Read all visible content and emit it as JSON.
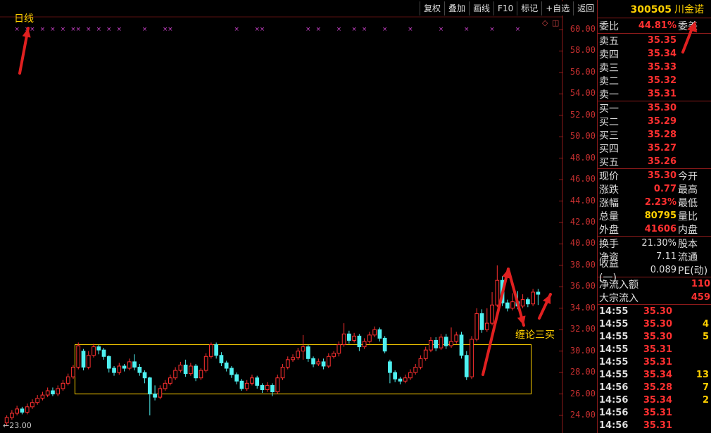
{
  "chart_title": "日线",
  "annotation_chan": "缠论三买",
  "toolbar": [
    "复权",
    "叠加",
    "画线",
    "F10",
    "标记",
    "+自选",
    "返回"
  ],
  "price_axis": [
    "60.00",
    "58.00",
    "56.00",
    "54.00",
    "52.00",
    "50.00",
    "48.00",
    "46.00",
    "44.00",
    "42.00",
    "40.00",
    "38.00",
    "36.00",
    "34.00",
    "32.00",
    "30.00",
    "28.00",
    "26.00",
    "24.00"
  ],
  "bottom_label": "←23.00",
  "stock": {
    "code": "300505",
    "name": "川金诺"
  },
  "weibi": {
    "label": "委比",
    "value": "44.81%",
    "label2": "委差"
  },
  "asks": [
    {
      "label": "卖五",
      "price": "35.35"
    },
    {
      "label": "卖四",
      "price": "35.34"
    },
    {
      "label": "卖三",
      "price": "35.33"
    },
    {
      "label": "卖二",
      "price": "35.32"
    },
    {
      "label": "卖一",
      "price": "35.31"
    }
  ],
  "bids": [
    {
      "label": "买一",
      "price": "35.30"
    },
    {
      "label": "买二",
      "price": "35.29"
    },
    {
      "label": "买三",
      "price": "35.28"
    },
    {
      "label": "买四",
      "price": "35.27"
    },
    {
      "label": "买五",
      "price": "35.26"
    }
  ],
  "quote": [
    {
      "label": "现价",
      "value": "35.30",
      "label2": "今开",
      "color": "#ff3030"
    },
    {
      "label": "涨跌",
      "value": "0.77",
      "label2": "最高",
      "color": "#ff3030"
    },
    {
      "label": "涨幅",
      "value": "2.23%",
      "label2": "最低",
      "color": "#ff3030"
    },
    {
      "label": "总量",
      "value": "80795",
      "label2": "量比",
      "color": "#ffd000"
    },
    {
      "label": "外盘",
      "value": "41606",
      "label2": "内盘",
      "color": "#ff3030"
    }
  ],
  "stats": [
    {
      "label": "换手",
      "value": "21.30%",
      "label2": "股本"
    },
    {
      "label": "净资",
      "value": "7.11",
      "label2": "流通"
    },
    {
      "label": "收益(一)",
      "value": "0.089",
      "label2": "PE(动)"
    }
  ],
  "flows": [
    {
      "label": "净流入额",
      "value": "110"
    },
    {
      "label": "大宗流入",
      "value": "459"
    }
  ],
  "ticks": [
    {
      "time": "14:55",
      "price": "35.30",
      "vol": "",
      "color": "#ff3030"
    },
    {
      "time": "14:55",
      "price": "35.30",
      "vol": "4",
      "color": "#ff3030"
    },
    {
      "time": "14:55",
      "price": "35.30",
      "vol": "5",
      "color": "#ff3030"
    },
    {
      "time": "14:55",
      "price": "35.31",
      "vol": "",
      "color": "#ff3030"
    },
    {
      "time": "14:55",
      "price": "35.31",
      "vol": "",
      "color": "#ff3030"
    },
    {
      "time": "14:55",
      "price": "35.34",
      "vol": "13",
      "color": "#ff3030"
    },
    {
      "time": "14:56",
      "price": "35.28",
      "vol": "7",
      "color": "#ff3030"
    },
    {
      "time": "14:56",
      "price": "35.34",
      "vol": "2",
      "color": "#ff3030"
    },
    {
      "time": "14:56",
      "price": "35.31",
      "vol": "",
      "color": "#ff3030"
    },
    {
      "time": "14:56",
      "price": "35.31",
      "vol": "",
      "color": "#ff3030"
    }
  ],
  "colors": {
    "up": "#ff3030",
    "down": "#4ff0f0",
    "box": "#ffd000",
    "grid": "#5a0f0f",
    "marker": "#cc44cc",
    "arrow": "#e02020"
  },
  "chart_data": {
    "type": "candlestick",
    "ylim": [
      23,
      61
    ],
    "candles": [
      [
        23.3,
        23.8,
        23.0,
        24.0
      ],
      [
        23.8,
        24.2,
        23.6,
        24.5
      ],
      [
        24.2,
        24.6,
        24.0,
        24.9
      ],
      [
        24.6,
        24.3,
        24.1,
        24.8
      ],
      [
        24.3,
        24.8,
        24.1,
        25.1
      ],
      [
        24.8,
        25.2,
        24.6,
        25.5
      ],
      [
        25.2,
        25.6,
        25.0,
        25.9
      ],
      [
        25.6,
        25.9,
        25.4,
        26.2
      ],
      [
        25.9,
        26.3,
        25.7,
        26.6
      ],
      [
        26.3,
        26.0,
        25.8,
        26.6
      ],
      [
        26.0,
        26.5,
        25.8,
        26.8
      ],
      [
        26.5,
        27.0,
        26.3,
        27.3
      ],
      [
        27.0,
        27.6,
        26.8,
        27.9
      ],
      [
        27.6,
        28.5,
        27.4,
        28.7
      ],
      [
        28.5,
        30.5,
        28.3,
        30.8
      ],
      [
        30.0,
        28.5,
        28.2,
        30.2
      ],
      [
        28.5,
        29.6,
        28.3,
        30.0
      ],
      [
        29.6,
        30.4,
        29.4,
        30.7
      ],
      [
        30.4,
        30.1,
        29.7,
        30.6
      ],
      [
        30.1,
        29.5,
        29.2,
        30.3
      ],
      [
        29.5,
        28.4,
        28.0,
        29.6
      ],
      [
        28.4,
        28.0,
        27.7,
        28.6
      ],
      [
        28.0,
        28.6,
        27.8,
        28.9
      ],
      [
        28.6,
        28.4,
        28.1,
        28.8
      ],
      [
        28.4,
        29.0,
        28.2,
        29.3
      ],
      [
        29.0,
        28.5,
        28.2,
        29.7
      ],
      [
        28.5,
        28.0,
        27.7,
        28.8
      ],
      [
        28.0,
        27.5,
        27.0,
        28.2
      ],
      [
        27.5,
        26.0,
        24.0,
        27.6
      ],
      [
        26.0,
        25.7,
        25.4,
        26.8
      ],
      [
        25.7,
        26.5,
        25.5,
        26.8
      ],
      [
        26.5,
        27.0,
        26.3,
        27.3
      ],
      [
        27.0,
        27.5,
        26.8,
        27.8
      ],
      [
        27.5,
        28.2,
        27.3,
        28.5
      ],
      [
        28.2,
        28.7,
        28.0,
        29.0
      ],
      [
        28.7,
        27.9,
        27.6,
        29.2
      ],
      [
        27.9,
        28.6,
        27.7,
        28.9
      ],
      [
        28.6,
        27.5,
        27.2,
        28.8
      ],
      [
        27.5,
        28.2,
        27.3,
        28.4
      ],
      [
        28.2,
        29.5,
        28.0,
        29.8
      ],
      [
        29.5,
        30.6,
        29.3,
        30.8
      ],
      [
        30.6,
        29.6,
        29.3,
        30.8
      ],
      [
        29.6,
        28.9,
        28.6,
        29.9
      ],
      [
        28.9,
        28.4,
        28.1,
        29.1
      ],
      [
        28.4,
        27.8,
        27.5,
        28.6
      ],
      [
        27.8,
        27.2,
        26.9,
        28.0
      ],
      [
        27.2,
        26.5,
        26.3,
        27.4
      ],
      [
        26.5,
        27.0,
        26.3,
        27.3
      ],
      [
        27.0,
        27.5,
        26.8,
        27.8
      ],
      [
        27.5,
        26.8,
        26.5,
        27.7
      ],
      [
        26.8,
        26.4,
        26.1,
        27.0
      ],
      [
        26.4,
        26.8,
        26.2,
        27.1
      ],
      [
        26.8,
        26.2,
        25.8,
        27.0
      ],
      [
        26.2,
        27.5,
        26.0,
        27.8
      ],
      [
        27.5,
        28.5,
        27.3,
        28.8
      ],
      [
        28.5,
        29.2,
        28.3,
        29.5
      ],
      [
        29.2,
        29.4,
        29.0,
        29.7
      ],
      [
        29.4,
        30.0,
        29.2,
        30.3
      ],
      [
        30.0,
        30.4,
        29.2,
        31.5
      ],
      [
        30.4,
        29.3,
        29.0,
        30.6
      ],
      [
        29.3,
        28.8,
        28.5,
        29.5
      ],
      [
        28.8,
        29.0,
        28.6,
        29.3
      ],
      [
        29.0,
        28.6,
        28.3,
        29.3
      ],
      [
        28.6,
        29.5,
        28.4,
        29.8
      ],
      [
        29.5,
        29.8,
        29.3,
        30.0
      ],
      [
        29.8,
        30.6,
        29.5,
        30.9
      ],
      [
        30.6,
        31.6,
        30.4,
        32.6
      ],
      [
        31.6,
        31.0,
        30.7,
        31.9
      ],
      [
        31.0,
        31.4,
        30.8,
        31.7
      ],
      [
        31.4,
        30.4,
        30.0,
        31.6
      ],
      [
        30.4,
        30.9,
        30.2,
        31.2
      ],
      [
        30.9,
        31.5,
        30.7,
        31.8
      ],
      [
        31.5,
        32.0,
        31.3,
        32.3
      ],
      [
        32.0,
        31.2,
        30.9,
        32.2
      ],
      [
        31.2,
        30.0,
        29.8,
        31.4
      ],
      [
        29.0,
        28.0,
        27.0,
        29.2
      ],
      [
        28.0,
        27.4,
        27.1,
        28.2
      ],
      [
        27.4,
        27.2,
        26.9,
        27.6
      ],
      [
        27.2,
        27.5,
        27.0,
        27.8
      ],
      [
        27.5,
        28.0,
        27.3,
        28.3
      ],
      [
        28.0,
        28.5,
        27.8,
        28.8
      ],
      [
        28.5,
        29.3,
        28.3,
        29.6
      ],
      [
        29.3,
        30.1,
        29.1,
        30.4
      ],
      [
        30.1,
        31.0,
        29.9,
        31.3
      ],
      [
        31.0,
        30.3,
        30.0,
        31.3
      ],
      [
        30.3,
        31.3,
        30.1,
        31.6
      ],
      [
        31.3,
        30.5,
        30.2,
        31.6
      ],
      [
        30.5,
        30.9,
        30.3,
        32.2
      ],
      [
        30.9,
        31.5,
        30.7,
        31.8
      ],
      [
        31.5,
        29.6,
        29.3,
        31.8
      ],
      [
        29.6,
        27.6,
        27.3,
        30.0
      ],
      [
        27.6,
        31.1,
        27.4,
        31.4
      ],
      [
        31.1,
        33.5,
        30.9,
        34.0
      ],
      [
        33.5,
        32.0,
        31.7,
        33.9
      ],
      [
        32.0,
        32.6,
        31.8,
        34.0
      ],
      [
        32.6,
        34.3,
        32.4,
        35.5
      ],
      [
        34.3,
        36.6,
        34.1,
        38.0
      ],
      [
        36.6,
        34.5,
        34.2,
        37.0
      ],
      [
        34.5,
        34.0,
        33.7,
        34.8
      ],
      [
        34.0,
        34.6,
        33.8,
        35.4
      ],
      [
        34.6,
        34.2,
        33.9,
        35.6
      ],
      [
        34.2,
        34.8,
        34.0,
        35.3
      ],
      [
        34.8,
        34.4,
        34.1,
        35.0
      ],
      [
        34.4,
        35.5,
        34.2,
        35.8
      ],
      [
        35.5,
        35.3,
        34.3,
        35.8
      ]
    ],
    "box": {
      "x_start": 14,
      "x_end": 103,
      "y_low": 26.0,
      "y_high": 30.6
    },
    "marker_positions": [
      2,
      4,
      5,
      7,
      9,
      11,
      13,
      14,
      16,
      18,
      20,
      22,
      27,
      31,
      32,
      45,
      49,
      50,
      59,
      61,
      65,
      68,
      70,
      74,
      79,
      85,
      90,
      95,
      100
    ]
  }
}
